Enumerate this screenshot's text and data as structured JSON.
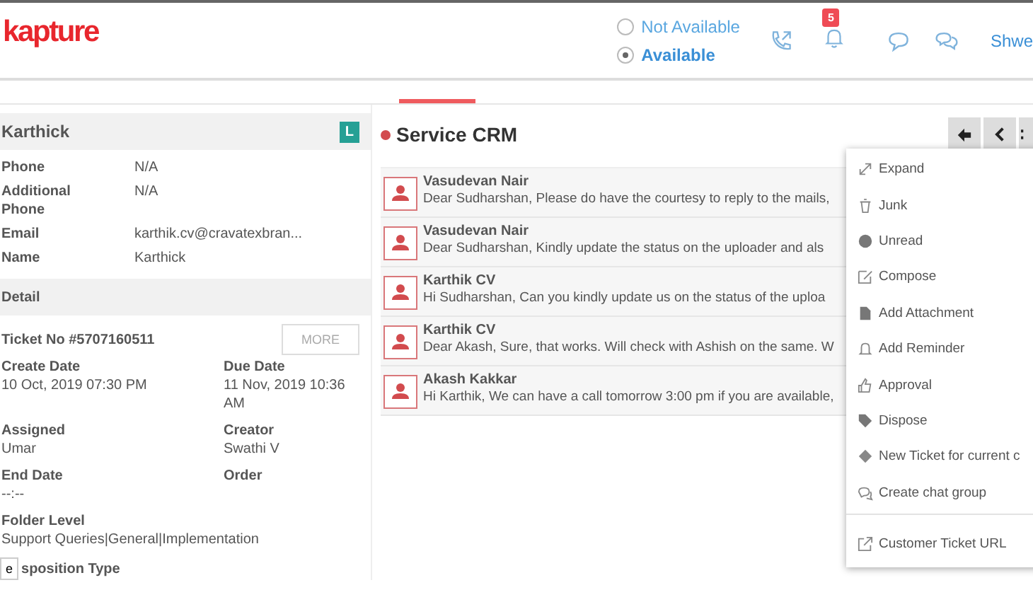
{
  "header": {
    "logo": "kapture",
    "availability": [
      {
        "label": "Not Available",
        "selected": false
      },
      {
        "label": "Available",
        "selected": true
      }
    ],
    "notification_count": "5",
    "user_name": "Shwe"
  },
  "contact": {
    "name": "Karthick",
    "badge": "L",
    "fields": [
      {
        "label": "Phone",
        "value": "N/A"
      },
      {
        "label": "Additional Phone",
        "value": "N/A"
      },
      {
        "label": "Email",
        "value": "karthik.cv@cravatexbran..."
      },
      {
        "label": "Name",
        "value": "Karthick"
      }
    ]
  },
  "detail": {
    "title": "Detail",
    "ticket_no": "Ticket No #5707160511",
    "more_button": "MORE",
    "pairs": [
      [
        {
          "label": "Create Date",
          "value": "10 Oct, 2019 07:30 PM"
        },
        {
          "label": "Due Date",
          "value": "11 Nov, 2019 10:36 AM"
        }
      ],
      [
        {
          "label": "Assigned",
          "value": "Umar"
        },
        {
          "label": "Creator",
          "value": "Swathi V"
        }
      ],
      [
        {
          "label": "End Date",
          "value": "--:--"
        },
        {
          "label": "Order"
        }
      ]
    ],
    "folder_level": {
      "label": "Folder Level",
      "value": "Support Queries|General|Implementation"
    },
    "cut_label": "sposition Type",
    "side_button": "e"
  },
  "conversation": {
    "title": "Service CRM",
    "messages": [
      {
        "sender": "Vasudevan Nair",
        "preview": "Dear Sudharshan, Please do have the courtesy to reply to the mails,"
      },
      {
        "sender": "Vasudevan Nair",
        "preview": "Dear Sudharshan,  Kindly update the status on the uploader and als"
      },
      {
        "sender": "Karthik CV",
        "preview": "Hi Sudharshan, Can you kindly update us on the status of the uploa"
      },
      {
        "sender": "Karthik CV",
        "preview": "Dear Akash, Sure, that works. Will check with Ashish on the same. W"
      },
      {
        "sender": "Akash Kakkar",
        "preview": "Hi Karthik, We can have a call tomorrow 3:00 pm if you are available,"
      }
    ]
  },
  "menu": {
    "items": [
      "Expand",
      "Junk",
      "Unread",
      "Compose",
      "Add Attachment",
      "Add Reminder",
      "Approval",
      "Dispose",
      "New Ticket for current c",
      "Create chat group"
    ],
    "footer_items": [
      "Customer Ticket URL"
    ]
  }
}
